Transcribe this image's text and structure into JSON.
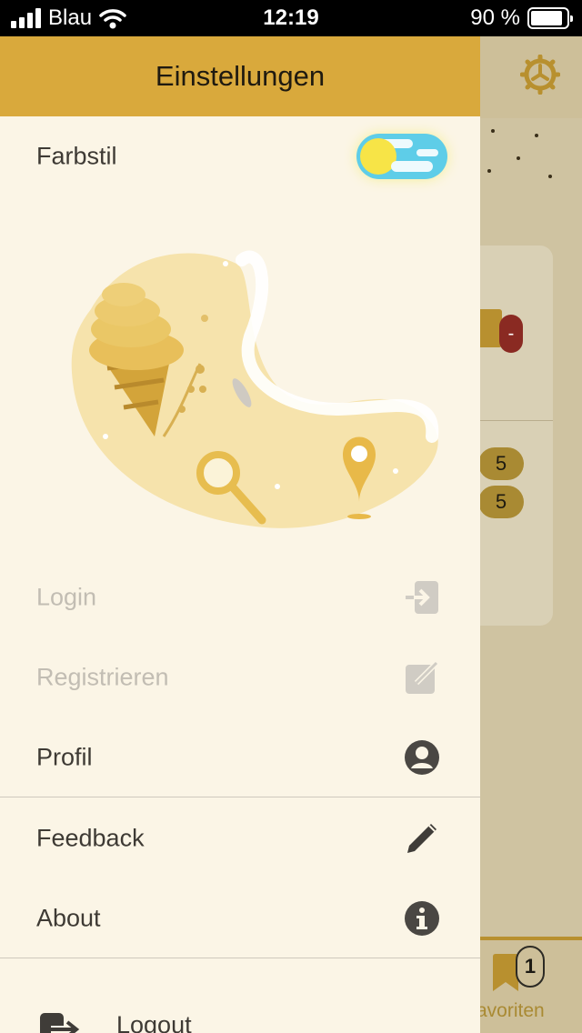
{
  "status_bar": {
    "carrier": "Blau",
    "time": "12:19",
    "battery_percent": "90 %",
    "battery_level": 0.9
  },
  "drawer": {
    "title": "Einstellungen",
    "color_style_label": "Farbstil",
    "color_style_mode": "light",
    "menu": {
      "login": "Login",
      "register": "Registrieren",
      "profile": "Profil",
      "feedback": "Feedback",
      "about": "About",
      "logout": "Logout"
    }
  },
  "background": {
    "count_1": "5",
    "count_2": "5",
    "remove_label": "-",
    "favorites_badge": "1",
    "favorites_tab_label": "avoriten"
  },
  "colors": {
    "header": "#d9a93c",
    "drawer_bg": "#fbf5e6",
    "accent": "#e0b94a",
    "text": "#3e3a34",
    "disabled_text": "#c2bdb3"
  }
}
